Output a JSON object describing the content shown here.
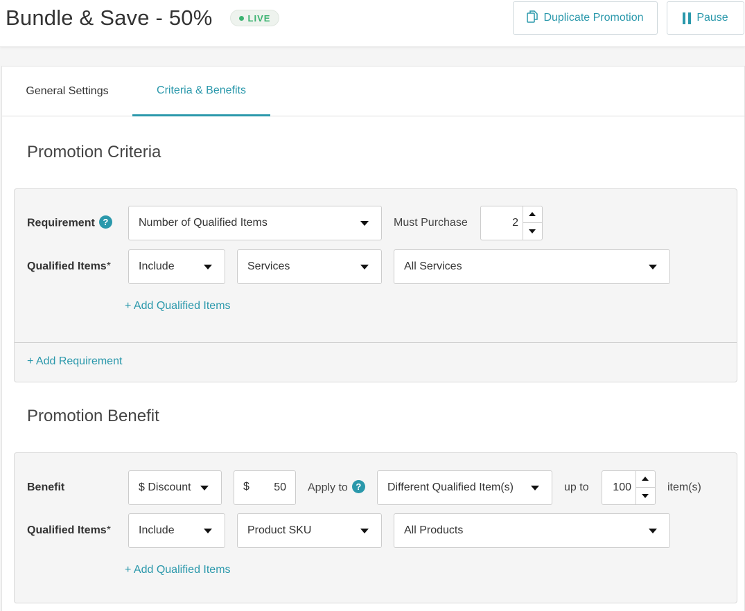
{
  "header": {
    "title": "Bundle & Save - 50%",
    "status": "LIVE",
    "duplicate_label": "Duplicate Promotion",
    "pause_label": "Pause"
  },
  "tabs": [
    {
      "label": "General Settings",
      "active": false
    },
    {
      "label": "Criteria & Benefits",
      "active": true
    }
  ],
  "criteria": {
    "title": "Promotion Criteria",
    "requirement_label": "Requirement",
    "requirement_help": "?",
    "requirement_type": "Number of Qualified Items",
    "must_purchase_label": "Must Purchase",
    "must_purchase_value": "2",
    "qualified_label": "Qualified Items",
    "required_mark": "*",
    "include": "Include",
    "item_type": "Services",
    "items": "All Services",
    "add_qualified": "+ Add Qualified Items",
    "add_requirement": "+ Add Requirement"
  },
  "benefit": {
    "title": "Promotion Benefit",
    "benefit_label": "Benefit",
    "benefit_type": "$ Discount",
    "currency": "$",
    "amount": "50",
    "apply_to_label": "Apply to",
    "apply_help": "?",
    "apply_to": "Different Qualified Item(s)",
    "up_to_label": "up to",
    "up_to_value": "100",
    "items_suffix": "item(s)",
    "qualified_label": "Qualified Items",
    "required_mark": "*",
    "include": "Include",
    "item_type": "Product SKU",
    "items": "All Products",
    "add_qualified": "+ Add Qualified Items"
  },
  "colors": {
    "accent": "#2a98ab",
    "live": "#3cb371",
    "panel_bg": "#f5f5f5"
  }
}
